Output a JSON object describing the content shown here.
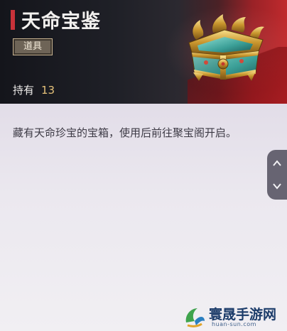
{
  "item": {
    "name": "天命宝鉴",
    "category": "道具",
    "owned_label": "持有",
    "owned_count": "13",
    "description": "藏有天命珍宝的宝箱，使用后前往聚宝阁开启。",
    "icon": "treasure-chest-icon"
  },
  "scrollbar": {
    "up_icon": "chevron-up-icon",
    "down_icon": "chevron-down-icon"
  },
  "watermark": {
    "name": "寰晟手游网",
    "url": "huan-sun.com"
  },
  "colors": {
    "accent_red": "#c8323a",
    "count_gold": "#e6c27a",
    "header_dark": "#1f2027",
    "body_bg": "#ebe8ef"
  }
}
